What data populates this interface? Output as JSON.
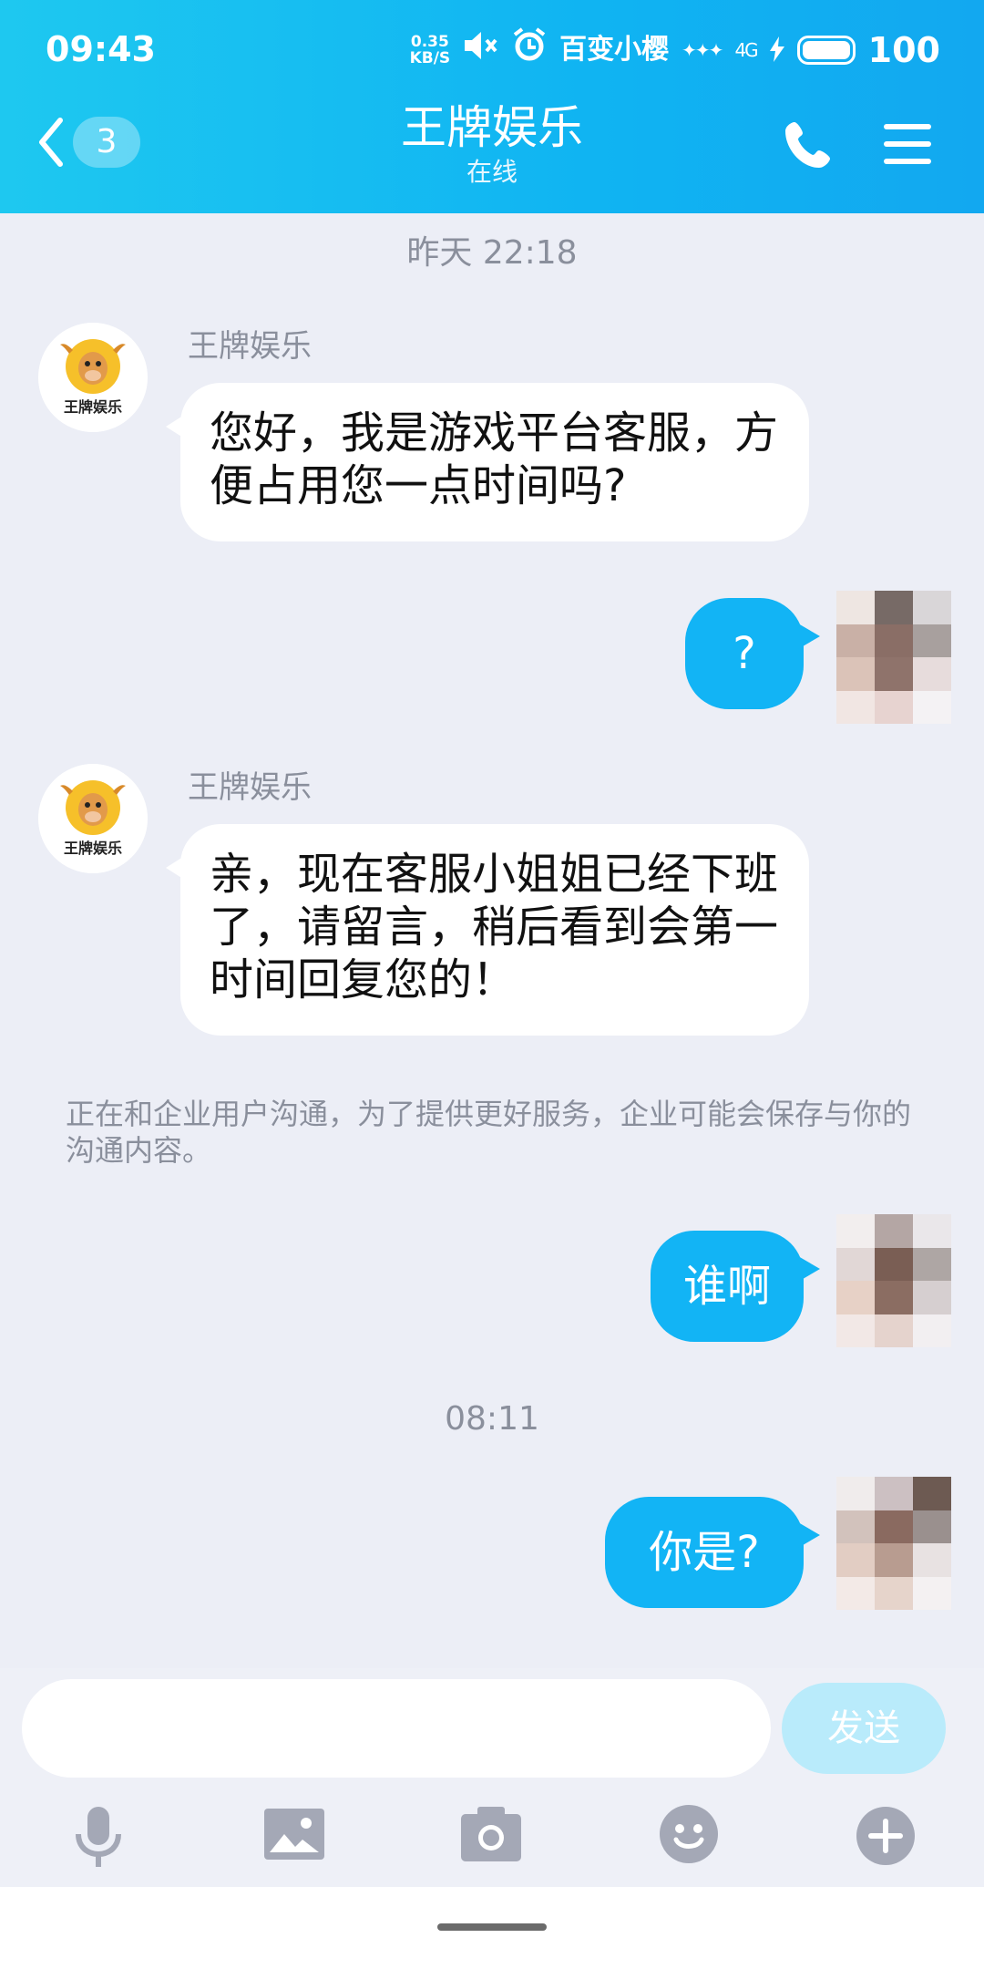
{
  "status_bar": {
    "time": "09:43",
    "speed_value": "0.35",
    "speed_unit": "KB/S",
    "carrier": "百变小樱",
    "network": "4G",
    "battery": "100"
  },
  "header": {
    "back_count": "3",
    "title": "王牌娱乐",
    "status": "在线"
  },
  "messages": {
    "time_1": "昨天 22:18",
    "sender_1": "王牌娱乐",
    "logo_text": "王牌娱乐",
    "in_1": "您好，我是游戏平台客服，方便占用您一点时间吗?",
    "out_1": "?",
    "sender_2": "王牌娱乐",
    "in_2": "亲，现在客服小姐姐已经下班了，请留言，稍后看到会第一时间回复您的！",
    "notice": "正在和企业用户沟通，为了提供更好服务，企业可能会保存与你的沟通内容。",
    "out_2": "谁啊",
    "time_2": "08:11",
    "out_3": "你是?"
  },
  "input": {
    "value": "",
    "send_label": "发送"
  },
  "colors": {
    "header": "#12b4f2",
    "bubble_out": "#12b4f5",
    "send_disabled": "#b9ebfb"
  },
  "icons": [
    "back-chevron-icon",
    "phone-icon",
    "menu-icon",
    "microphone-icon",
    "image-icon",
    "camera-icon",
    "emoji-icon",
    "plus-icon"
  ]
}
